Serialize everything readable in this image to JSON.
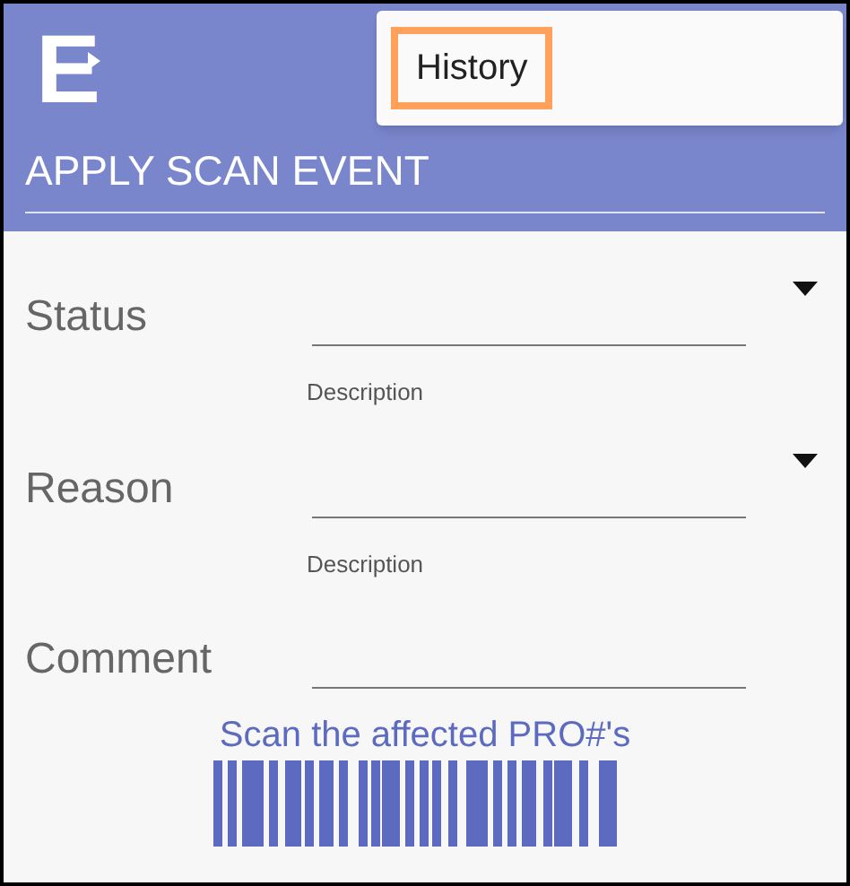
{
  "logo": "E",
  "menu": {
    "items": [
      {
        "label": "History",
        "highlighted": true
      }
    ]
  },
  "section_title": "APPLY SCAN EVENT",
  "fields": [
    {
      "kind": "dropdown",
      "label": "Status",
      "helper": "Description"
    },
    {
      "kind": "dropdown",
      "label": "Reason",
      "helper": "Description"
    },
    {
      "kind": "text",
      "label": "Comment"
    }
  ],
  "scan_prompt": "Scan the affected PRO#'s"
}
